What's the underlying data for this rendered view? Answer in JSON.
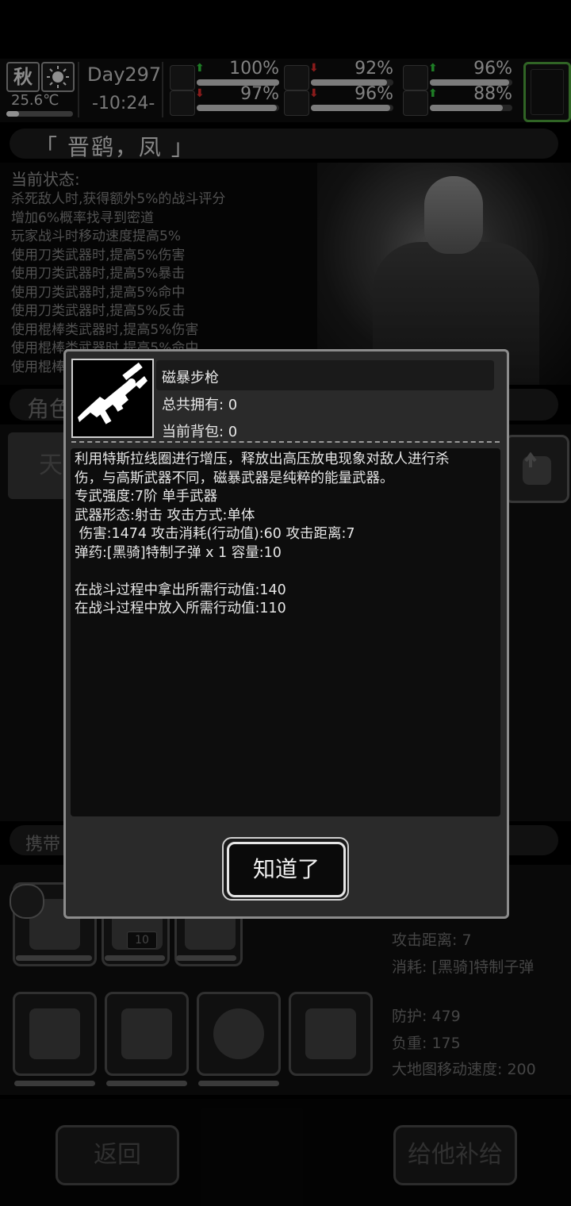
{
  "status": {
    "season": "秋",
    "temperature": "25.6℃",
    "day": "Day297",
    "time": "-10:24-",
    "stats": [
      {
        "icon": "medkit-icon",
        "value": "100%",
        "level": 1.0,
        "trend": "up"
      },
      {
        "icon": "stomach-icon",
        "value": "92%",
        "level": 0.92,
        "trend": "down"
      },
      {
        "icon": "pill-icon",
        "value": "96%",
        "level": 0.96,
        "trend": "up"
      },
      {
        "icon": "leg-icon",
        "value": "97%",
        "level": 0.97,
        "trend": "down"
      },
      {
        "icon": "water-drop-icon",
        "value": "96%",
        "level": 0.96,
        "trend": "down"
      },
      {
        "icon": "heart-icon",
        "value": "88%",
        "level": 0.88,
        "trend": "up"
      }
    ]
  },
  "character": {
    "name": "「 晋鹞，凤 」",
    "state_title": "当前状态:",
    "effects": [
      "杀死敌人时,获得额外5%的战斗评分",
      "增加6%概率找寻到密道",
      "玩家战斗时移动速度提高5%",
      "使用刀类武器时,提高5%伤害",
      "使用刀类武器时,提高5%暴击",
      "使用刀类武器时,提高5%命中",
      "使用刀类武器时,提高5%反击",
      "使用棍棒类武器时,提高5%伤害",
      "使用棍棒类武器时,提高5%命中",
      "使用棍棒"
    ],
    "role_label": "角色",
    "tab_label": "天",
    "carry_label": "携带",
    "weapon_slot_count": "10"
  },
  "weapon_stats": {
    "range": "攻击距离: 7",
    "ammo_cost": "消耗: [黑骑]特制子弹"
  },
  "gear_stats": {
    "defense": "防护: 479",
    "weight": "负重: 175",
    "map_speed": "大地图移动速度:  200"
  },
  "buttons": {
    "back": "返回",
    "supply": "给他补给"
  },
  "modal": {
    "item_name": "磁暴步枪",
    "owned": "总共拥有:   0",
    "in_bag": "当前背包:   0",
    "desc_lines": [
      "利用特斯拉线圈进行增压，释放出高压放电现象对敌人进行杀",
      "伤，与高斯武器不同，磁暴武器是纯粹的能量武器。",
      "专武强度:7阶 单手武器",
      "武器形态:射击 攻击方式:单体",
      " 伤害:1474 攻击消耗(行动值):60 攻击距离:7",
      "弹药:[黑骑]特制子弹 x 1 容量:10",
      "",
      "在战斗过程中拿出所需行动值:140",
      "在战斗过程中放入所需行动值:110"
    ],
    "ok_label": "知道了"
  }
}
